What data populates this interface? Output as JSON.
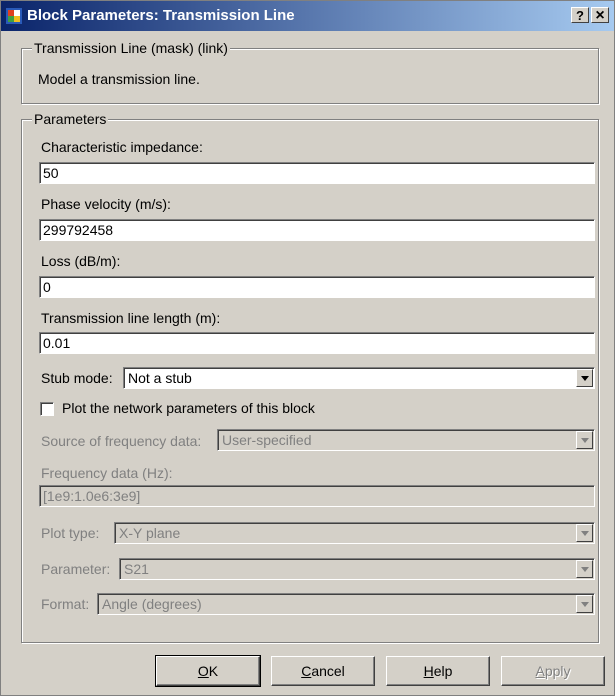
{
  "window": {
    "title": "Block Parameters: Transmission Line",
    "help_glyph": "?",
    "close_glyph": "×"
  },
  "mask_group": {
    "legend": "Transmission Line (mask) (link)",
    "description": "Model a transmission line."
  },
  "params_group": {
    "legend": "Parameters",
    "char_impedance": {
      "label": "Characteristic impedance:",
      "value": "50"
    },
    "phase_velocity": {
      "label": "Phase velocity (m/s):",
      "value": "299792458"
    },
    "loss": {
      "label": "Loss (dB/m):",
      "value": "0"
    },
    "line_length": {
      "label": "Transmission line length (m):",
      "value": "0.01"
    },
    "stub_mode": {
      "label": "Stub mode:",
      "value": "Not a stub"
    },
    "plot_checkbox": {
      "label": "Plot the network parameters of this block",
      "checked": false
    },
    "freq_source": {
      "label": "Source of frequency data:",
      "value": "User-specified"
    },
    "freq_data": {
      "label": "Frequency data (Hz):",
      "value": "[1e9:1.0e6:3e9]"
    },
    "plot_type": {
      "label": "Plot type:",
      "value": "X-Y plane"
    },
    "parameter": {
      "label": "Parameter:",
      "value": "S21"
    },
    "format": {
      "label": "Format:",
      "value": "Angle (degrees)"
    }
  },
  "buttons": {
    "ok": {
      "mnemonic": "O",
      "rest": "K"
    },
    "cancel": {
      "mnemonic": "C",
      "rest": "ancel"
    },
    "help": {
      "mnemonic": "H",
      "rest": "elp"
    },
    "apply": {
      "mnemonic": "A",
      "rest": "pply"
    }
  },
  "colors": {
    "titlebar_start": "#0a246a",
    "titlebar_end": "#a6caf0",
    "face": "#d4d0c8",
    "disabled_text": "#808080"
  }
}
